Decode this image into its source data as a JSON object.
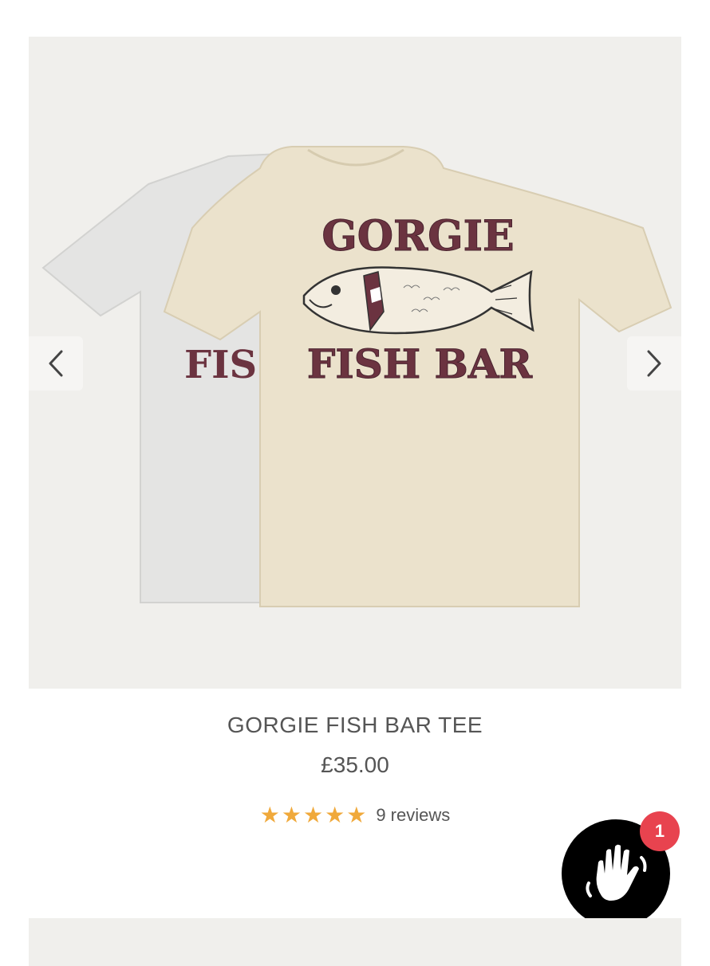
{
  "product": {
    "title": "GORGIE FISH BAR TEE",
    "price": "£35.00",
    "rating": 5,
    "reviews": "9 reviews",
    "shirt_print": {
      "line1": "GORGIE",
      "line2": "FISH BAR",
      "back_shirt_partial": "FIS"
    }
  },
  "gallery": {
    "prev_icon": "chevron-left-icon",
    "next_icon": "chevron-right-icon"
  },
  "widget": {
    "icon": "waving-hand-icon",
    "badge_count": "1"
  },
  "colors": {
    "background": "#ffffff",
    "gallery_bg": "#f0efec",
    "shirt_cream": "#ebe2cc",
    "shirt_white": "#e3e3e3",
    "print_maroon": "#6b3340",
    "text": "#555555",
    "star": "#f0a93b",
    "badge": "#e8434f"
  }
}
